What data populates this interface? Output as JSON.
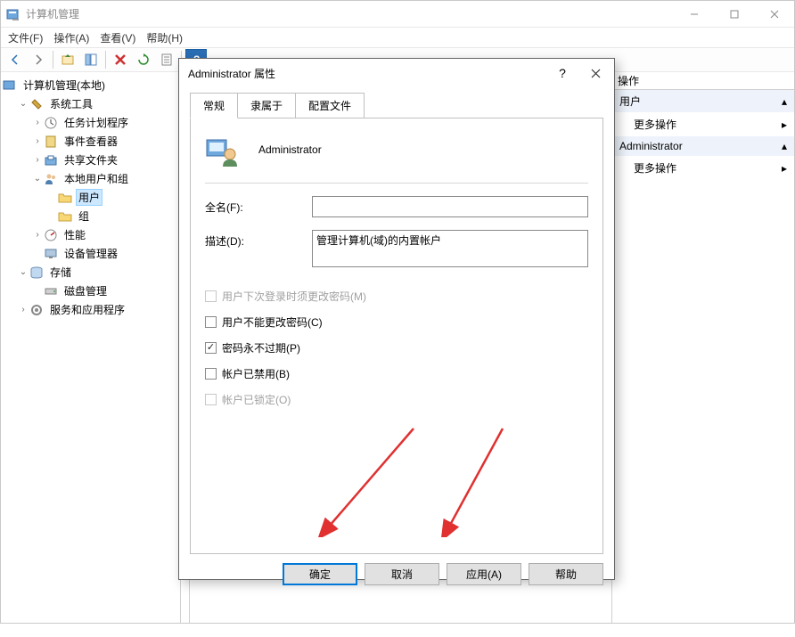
{
  "window": {
    "title": "计算机管理"
  },
  "menu": {
    "file": "文件(F)",
    "action": "操作(A)",
    "view": "查看(V)",
    "help": "帮助(H)"
  },
  "tree": {
    "root": "计算机管理(本地)",
    "system_tools": "系统工具",
    "task_scheduler": "任务计划程序",
    "event_viewer": "事件查看器",
    "shared_folders": "共享文件夹",
    "local_users_groups": "本地用户和组",
    "users": "用户",
    "groups": "组",
    "performance": "性能",
    "device_manager": "设备管理器",
    "storage": "存储",
    "disk_management": "磁盘管理",
    "services_apps": "服务和应用程序"
  },
  "actions": {
    "header": "操作",
    "group_users": "用户",
    "group_admin": "Administrator",
    "more": "更多操作"
  },
  "dialog": {
    "title": "Administrator 属性",
    "tab_general": "常规",
    "tab_memberof": "隶属于",
    "tab_profile": "配置文件",
    "username": "Administrator",
    "fullname_label": "全名(F):",
    "fullname_value": "",
    "description_label": "描述(D):",
    "description_value": "管理计算机(域)的内置帐户",
    "chk_must_change": "用户下次登录时须更改密码(M)",
    "chk_cannot_change": "用户不能更改密码(C)",
    "chk_never_expire": "密码永不过期(P)",
    "chk_disabled": "帐户已禁用(B)",
    "chk_locked": "帐户已锁定(O)",
    "btn_ok": "确定",
    "btn_cancel": "取消",
    "btn_apply": "应用(A)",
    "btn_help": "帮助"
  }
}
